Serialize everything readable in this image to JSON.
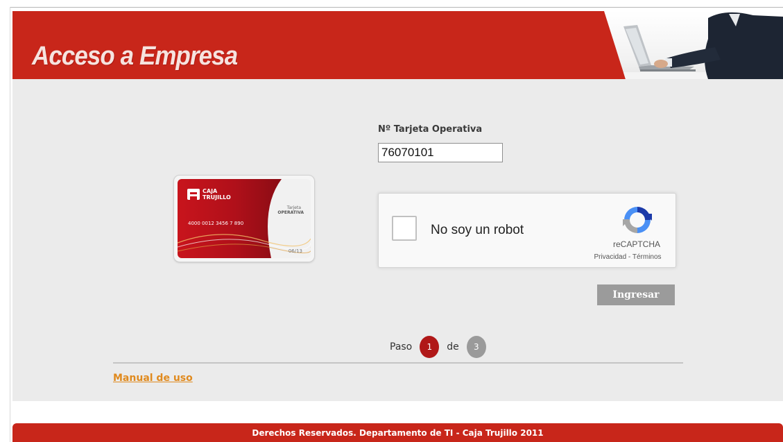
{
  "header": {
    "title": "Acceso a Empresa",
    "brand_color": "#c8261a"
  },
  "card": {
    "brand_line1": "CAJA",
    "brand_line2": "TRUJILLO",
    "type_line1": "Tarjeta",
    "type_line2": "OPERATIVA",
    "number": "4000 0012 3456 7 890",
    "expiry": "06/13"
  },
  "form": {
    "field_label": "Nº Tarjeta Operativa",
    "card_number_value": "76070101"
  },
  "recaptcha": {
    "label": "No soy un robot",
    "brand": "reCAPTCHA",
    "privacy_link": "Privacidad",
    "separator": " - ",
    "terms_link": "Términos"
  },
  "actions": {
    "submit_label": "Ingresar"
  },
  "steps": {
    "prefix": "Paso",
    "current": "1",
    "connector": "de",
    "total": "3"
  },
  "links": {
    "manual": "Manual de uso"
  },
  "footer": {
    "text": "Derechos Reservados. Departamento de TI - Caja Trujillo 2011"
  }
}
